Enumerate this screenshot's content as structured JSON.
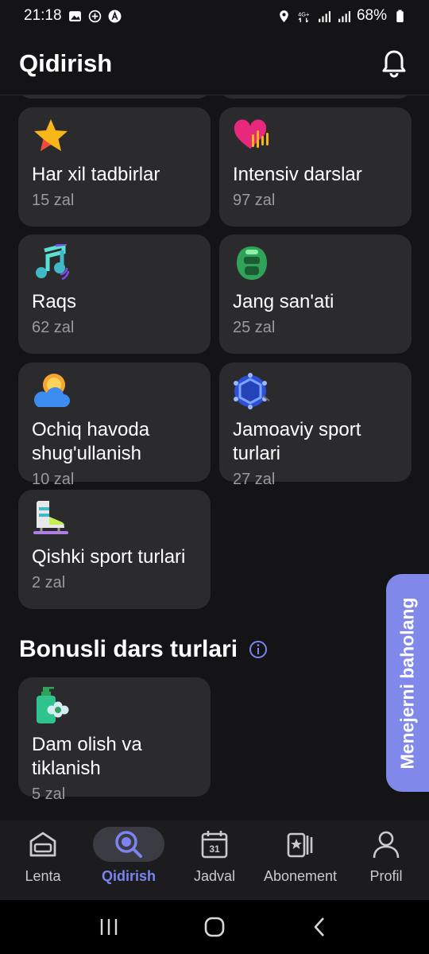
{
  "status_bar": {
    "time": "21:18",
    "battery": "68%"
  },
  "header": {
    "title": "Qidirish"
  },
  "categories": [
    {
      "name": "Har xil tadbirlar",
      "count": "15 zal",
      "icon": "star-icon"
    },
    {
      "name": "Intensiv darslar",
      "count": "97 zal",
      "icon": "heartbeat-icon"
    },
    {
      "name": "Raqs",
      "count": "62 zal",
      "icon": "music-note-icon"
    },
    {
      "name": "Jang san'ati",
      "count": "25 zal",
      "icon": "boxing-helmet-icon"
    },
    {
      "name": "Ochiq havoda shug'ullanish",
      "count": "10 zal",
      "icon": "sun-cloud-icon"
    },
    {
      "name": "Jamoaviy sport turlari",
      "count": "27 zal",
      "icon": "volleyball-icon"
    },
    {
      "name": "Qishki sport turlari",
      "count": "2 zal",
      "icon": "ice-skate-icon"
    }
  ],
  "bonus": {
    "title": "Bonusli dars turlari",
    "items": [
      {
        "name": "Dam olish va tiklanish",
        "count": "5 zal",
        "icon": "spa-bottle-icon"
      }
    ]
  },
  "rate_manager": {
    "label": "Menejerni baholang"
  },
  "bottom_nav": [
    {
      "label": "Lenta",
      "icon": "feed-icon",
      "active": false
    },
    {
      "label": "Qidirish",
      "icon": "search-icon",
      "active": true
    },
    {
      "label": "Jadval",
      "icon": "calendar-icon",
      "active": false,
      "badge": "31"
    },
    {
      "label": "Abonement",
      "icon": "membership-card-icon",
      "active": false
    },
    {
      "label": "Profil",
      "icon": "profile-icon",
      "active": false
    }
  ],
  "colors": {
    "accent": "#7b84f0",
    "card": "#2b2b2e",
    "background": "#141416",
    "rate_tab": "#8088ea"
  }
}
